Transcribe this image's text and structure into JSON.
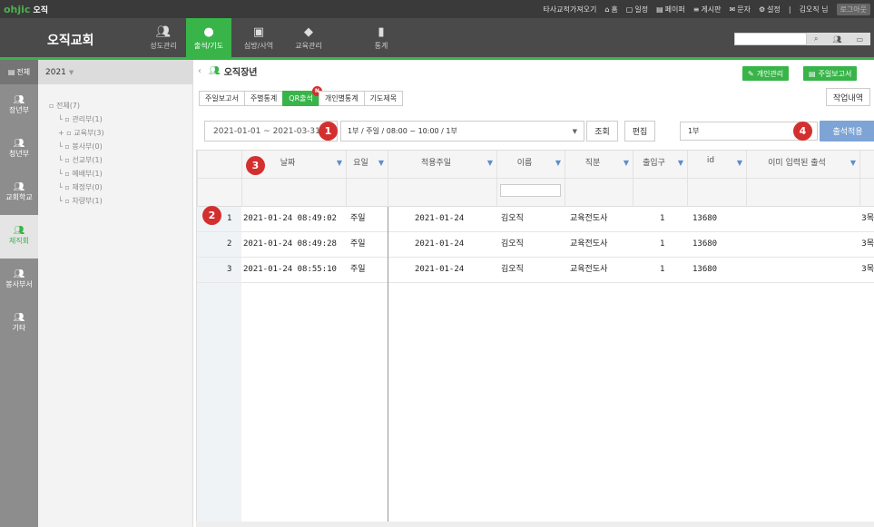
{
  "logo": {
    "brand": "ohjic",
    "app": "오직"
  },
  "toplinks": {
    "other_church": "타사교적가져오기",
    "home": "홈",
    "schedule": "일정",
    "paper": "페이퍼",
    "board": "게시판",
    "sms": "문자",
    "settings": "설정",
    "user": "김오직 님",
    "logout": "로그아웃"
  },
  "nav": {
    "church_name": "오직교회",
    "items": [
      {
        "label": "성도관리",
        "icon": "people-icon"
      },
      {
        "label": "출석/기도",
        "icon": "drop-icon"
      },
      {
        "label": "심방/사역",
        "icon": "briefcase-icon"
      },
      {
        "label": "교육관리",
        "icon": "graduation-cap-icon"
      },
      {
        "label": "통계",
        "icon": "bar-chart-icon"
      }
    ]
  },
  "sidebar": {
    "all": "전체",
    "items": [
      {
        "label": "장년부"
      },
      {
        "label": "청년부"
      },
      {
        "label": "교회학교"
      },
      {
        "label": "제직회"
      },
      {
        "label": "봉사부서"
      },
      {
        "label": "기타"
      }
    ]
  },
  "tree": {
    "year": "2021",
    "root": "전체(7)",
    "children": [
      "관리부(1)",
      "교육부(3)",
      "봉사부(0)",
      "선교부(1)",
      "예배부(1)",
      "재정부(0)",
      "차량부(1)"
    ]
  },
  "page": {
    "title": "오직장년",
    "btn_personal": "개인관리",
    "btn_weekly_report": "주일보고서",
    "work_history": "작업내역"
  },
  "tabs": [
    "주일보고서",
    "주별통계",
    "QR출석",
    "개인별통계",
    "기도제목"
  ],
  "tab_new_badge": "N",
  "filter": {
    "date_range": "2021-01-01 ~ 2021-03-31",
    "service": "1부 / 주일 / 08:00 ~ 10:00 / 1부",
    "search": "조회",
    "edit": "편집",
    "value": "1부",
    "apply": "출석적용"
  },
  "markers": [
    "1",
    "2",
    "3",
    "4"
  ],
  "columns": {
    "datetime": "날짜",
    "day": "요일",
    "applied_week": "적용주일",
    "name": "이름",
    "position": "직분",
    "entrance": "출입구",
    "id": "id",
    "already": "이미 입력된 출석"
  },
  "rows": [
    {
      "no": "1",
      "datetime": "2021-01-24 08:49:02",
      "day": "주일",
      "applied_week": "2021-01-24",
      "name": "김오직",
      "position": "교육전도사",
      "entrance": "1",
      "id": "13680",
      "extra": "3목"
    },
    {
      "no": "2",
      "datetime": "2021-01-24 08:49:28",
      "day": "주일",
      "applied_week": "2021-01-24",
      "name": "김오직",
      "position": "교육전도사",
      "entrance": "1",
      "id": "13680",
      "extra": "3목"
    },
    {
      "no": "3",
      "datetime": "2021-01-24 08:55:10",
      "day": "주일",
      "applied_week": "2021-01-24",
      "name": "김오직",
      "position": "교육전도사",
      "entrance": "1",
      "id": "13680",
      "extra": "3목"
    }
  ],
  "colors": {
    "accent": "#38b449",
    "marker": "#d32f2f",
    "apply_button": "#7ea4d6"
  }
}
